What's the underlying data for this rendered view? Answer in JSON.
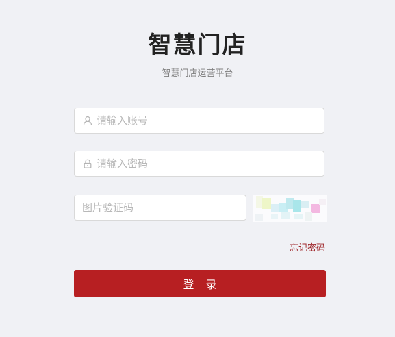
{
  "header": {
    "title": "智慧门店",
    "subtitle": "智慧门店运营平台"
  },
  "form": {
    "account_placeholder": "请输入账号",
    "password_placeholder": "请输入密码",
    "captcha_placeholder": "图片验证码",
    "forgot_password_label": "忘记密码",
    "login_label": "登 录"
  },
  "icons": {
    "account": "user-icon",
    "password": "lock-icon"
  },
  "colors": {
    "background": "#f0f1f5",
    "primary": "#b71f22",
    "forgot_link": "#a0292d"
  }
}
